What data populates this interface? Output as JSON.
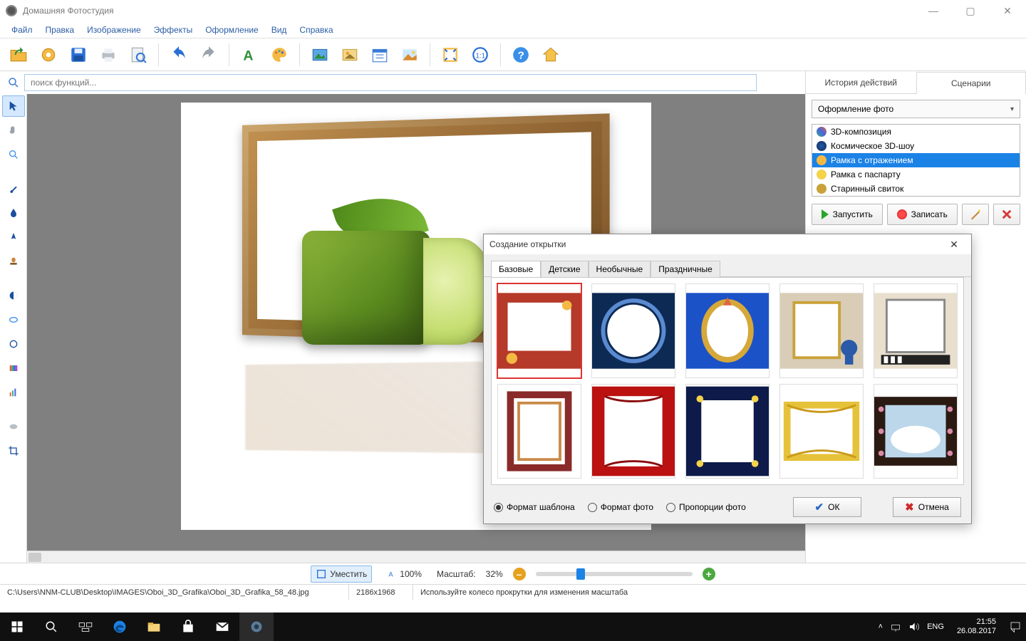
{
  "titlebar": {
    "appname": "Домашняя Фотостудия"
  },
  "menubar": [
    "Файл",
    "Правка",
    "Изображение",
    "Эффекты",
    "Оформление",
    "Вид",
    "Справка"
  ],
  "toolbar_icons": [
    "open-folder",
    "settings-gear",
    "save-disk",
    "print",
    "preview",
    "undo",
    "redo",
    "text-tool",
    "palette",
    "image-frame",
    "image",
    "calendar",
    "picture-sun",
    "stretch",
    "one-to-one",
    "help",
    "home3d"
  ],
  "search": {
    "placeholder": "поиск функций..."
  },
  "right": {
    "tabs": {
      "history": "История действий",
      "scenarios": "Сценарии"
    },
    "combo": "Оформление фото",
    "list": [
      "3D-композиция",
      "Космическое 3D-шоу",
      "Рамка с отражением",
      "Рамка с паспарту",
      "Старинный свиток"
    ],
    "selected_index": 2,
    "run": "Запустить",
    "record": "Записать"
  },
  "dialog": {
    "title": "Создание открытки",
    "tabs": [
      "Базовые",
      "Детские",
      "Необычные",
      "Праздничные"
    ],
    "radios": {
      "template": "Формат шаблона",
      "photo": "Формат фото",
      "proportion": "Пропорции фото"
    },
    "ok": "ОК",
    "cancel": "Отмена"
  },
  "fitbar": {
    "fit": "Уместить",
    "hundred": "100%",
    "scale_label": "Масштаб:",
    "scale_value": "32%"
  },
  "status": {
    "path": "C:\\Users\\NNM-CLUB\\Desktop\\IMAGES\\Oboi_3D_Grafika\\Oboi_3D_Grafika_58_48.jpg",
    "dims": "2186x1968",
    "hint": "Используйте колесо прокрутки для изменения масштаба"
  },
  "taskbar": {
    "lang": "ENG",
    "time": "21:55",
    "date": "26.08.2017"
  }
}
